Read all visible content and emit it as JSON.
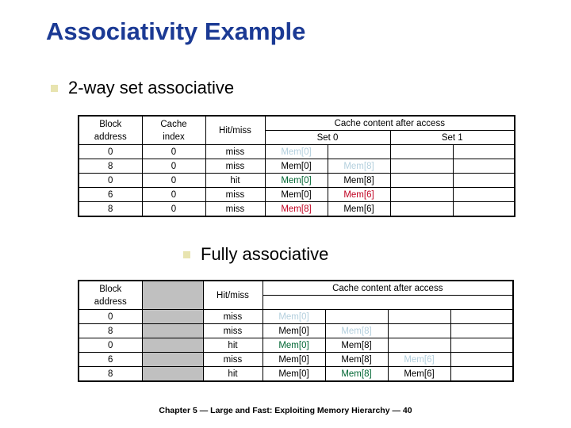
{
  "slide": {
    "title": "Associativity Example",
    "footer": "Chapter 5 — Large and Fast: Exploiting Memory Hierarchy — 40"
  },
  "bullets": [
    {
      "marker": "square-bullet",
      "label": "2-way set associative"
    },
    {
      "marker": "square-bullet",
      "label": "Fully associative"
    }
  ],
  "two_way_table": {
    "headers": {
      "block_address": "Block address",
      "block_address_line1": "Block",
      "block_address_line2": "address",
      "cache_index": "Cache index",
      "cache_index_line1": "Cache",
      "cache_index_line2": "index",
      "hit_miss": "Hit/miss",
      "cache_content": "Cache content after access",
      "set0": "Set 0",
      "set1": "Set 1"
    },
    "rows": [
      {
        "block_address": "0",
        "cache_index": "0",
        "hit_miss": "miss",
        "set0_a": "Mem[0]",
        "set0_a_style": "faint",
        "set0_b": "",
        "set0_b_style": "empty",
        "set1_a": "",
        "set1_a_style": "empty",
        "set1_b": "",
        "set1_b_style": "empty"
      },
      {
        "block_address": "8",
        "cache_index": "0",
        "hit_miss": "miss",
        "set0_a": "Mem[0]",
        "set0_a_style": "plain",
        "set0_b": "Mem[8]",
        "set0_b_style": "faint",
        "set1_a": "",
        "set1_a_style": "empty",
        "set1_b": "",
        "set1_b_style": "empty"
      },
      {
        "block_address": "0",
        "cache_index": "0",
        "hit_miss": "hit",
        "set0_a": "Mem[0]",
        "set0_a_style": "green",
        "set0_b": "Mem[8]",
        "set0_b_style": "plain",
        "set1_a": "",
        "set1_a_style": "empty",
        "set1_b": "",
        "set1_b_style": "empty"
      },
      {
        "block_address": "6",
        "cache_index": "0",
        "hit_miss": "miss",
        "set0_a": "Mem[0]",
        "set0_a_style": "plain",
        "set0_b": "Mem[6]",
        "set0_b_style": "red",
        "set1_a": "",
        "set1_a_style": "empty",
        "set1_b": "",
        "set1_b_style": "empty"
      },
      {
        "block_address": "8",
        "cache_index": "0",
        "hit_miss": "miss",
        "set0_a": "Mem[8]",
        "set0_a_style": "red",
        "set0_b": "Mem[6]",
        "set0_b_style": "plain",
        "set1_a": "",
        "set1_a_style": "empty",
        "set1_b": "",
        "set1_b_style": "empty"
      }
    ]
  },
  "fully_assoc_table": {
    "headers": {
      "block_address_line1": "Block",
      "block_address_line2": "address",
      "blank_col": "",
      "hit_miss": "Hit/miss",
      "cache_content": "Cache content after access"
    },
    "rows": [
      {
        "block_address": "0",
        "hit_miss": "miss",
        "w1": "Mem[0]",
        "w1_style": "faint",
        "w2": "",
        "w2_style": "empty",
        "w3": "",
        "w3_style": "empty",
        "w4": "",
        "w4_style": "empty"
      },
      {
        "block_address": "8",
        "hit_miss": "miss",
        "w1": "Mem[0]",
        "w1_style": "plain",
        "w2": "Mem[8]",
        "w2_style": "faint",
        "w3": "",
        "w3_style": "empty",
        "w4": "",
        "w4_style": "empty"
      },
      {
        "block_address": "0",
        "hit_miss": "hit",
        "w1": "Mem[0]",
        "w1_style": "green",
        "w2": "Mem[8]",
        "w2_style": "plain",
        "w3": "",
        "w3_style": "empty",
        "w4": "",
        "w4_style": "empty"
      },
      {
        "block_address": "6",
        "hit_miss": "miss",
        "w1": "Mem[0]",
        "w1_style": "plain",
        "w2": "Mem[8]",
        "w2_style": "plain",
        "w3": "Mem[6]",
        "w3_style": "faint",
        "w4": "",
        "w4_style": "empty"
      },
      {
        "block_address": "8",
        "hit_miss": "hit",
        "w1": "Mem[0]",
        "w1_style": "plain",
        "w2": "Mem[8]",
        "w2_style": "green",
        "w3": "Mem[6]",
        "w3_style": "plain",
        "w4": "",
        "w4_style": "empty"
      }
    ]
  },
  "colors": {
    "title": "#1b3a94",
    "bullet_marker": "#e8e4b0",
    "value_faint": "#b3cfdd",
    "value_green": "#006633",
    "value_red": "#c00020",
    "gray_fill": "#c0c0c0"
  }
}
